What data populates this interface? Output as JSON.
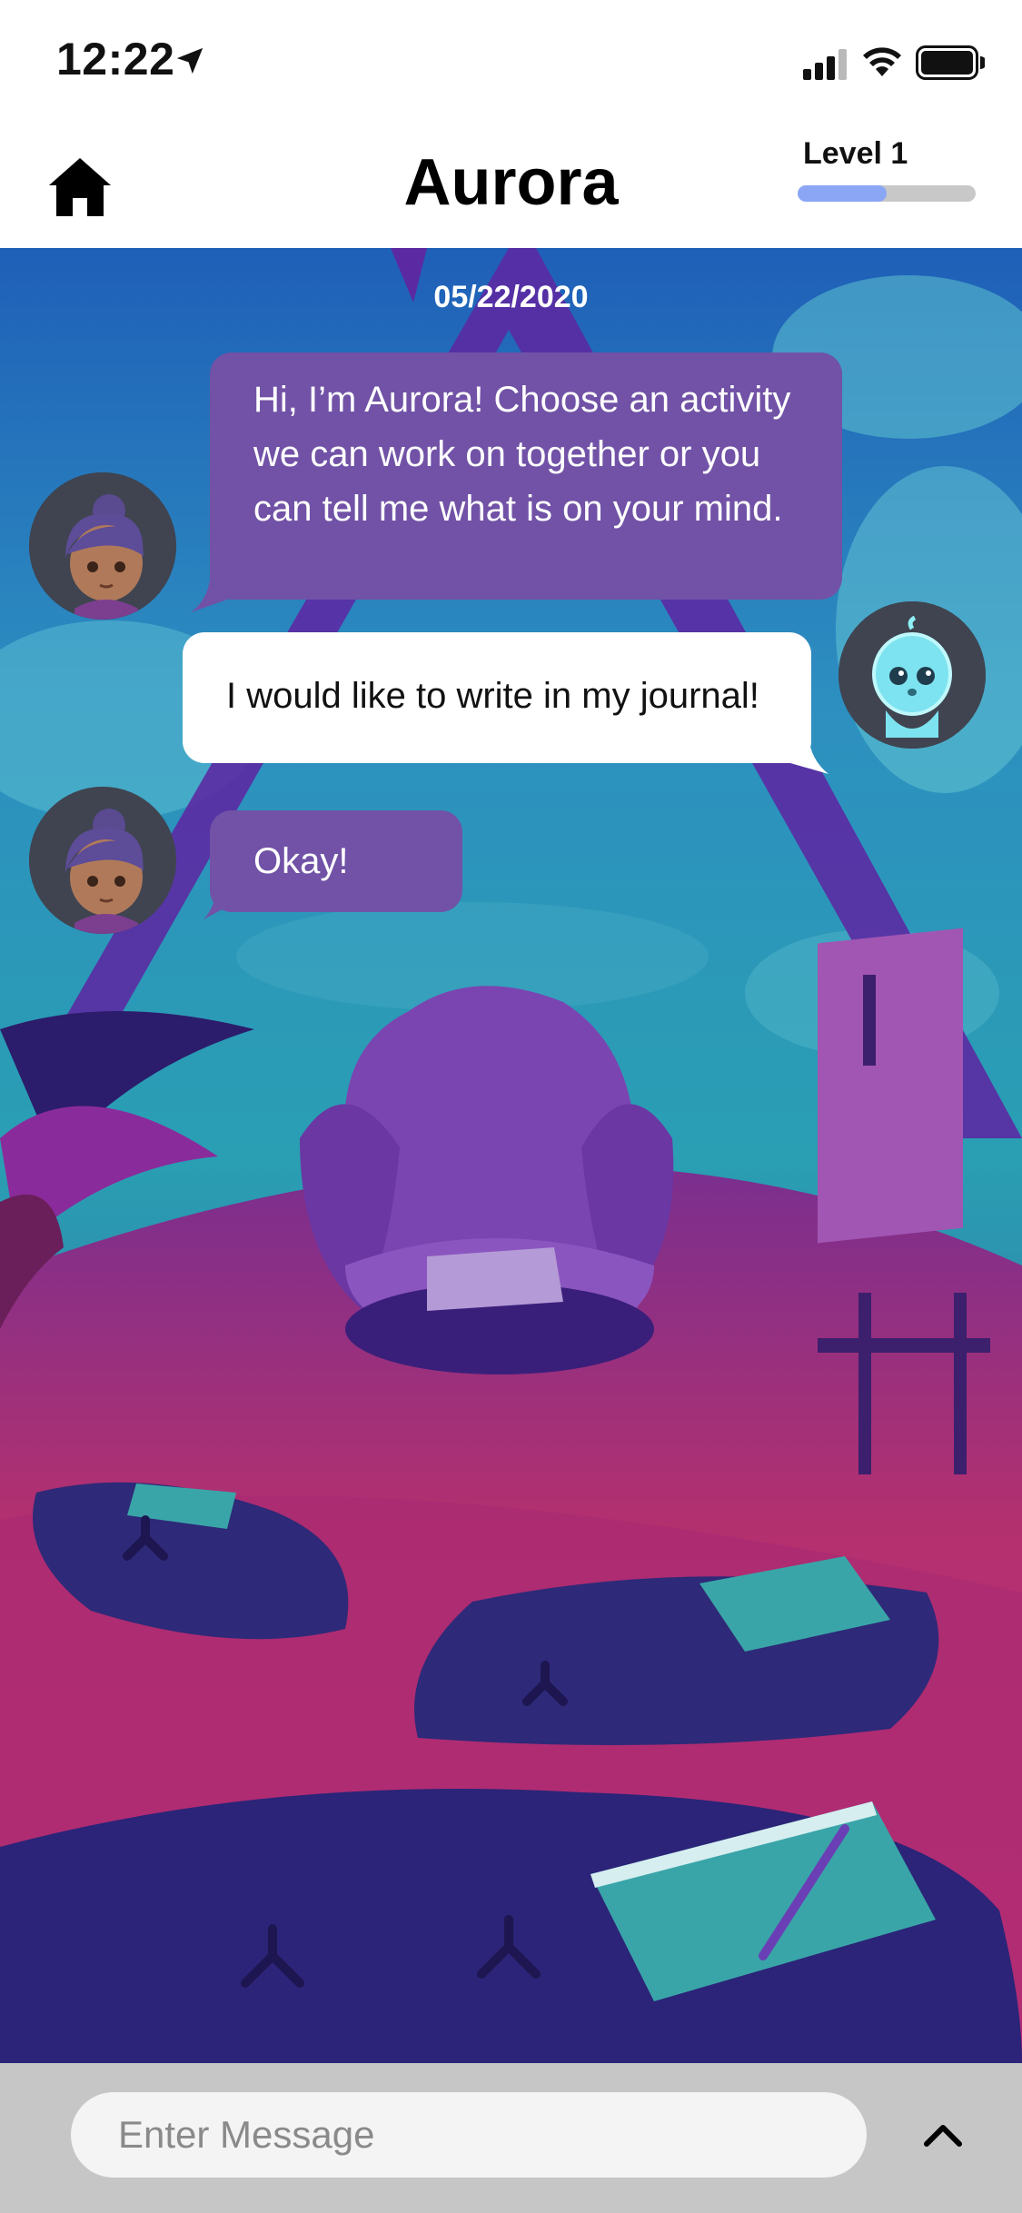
{
  "status_bar": {
    "time": "12:22"
  },
  "header": {
    "title": "Aurora",
    "level_label": "Level 1",
    "level_progress": 0.5
  },
  "chat": {
    "date": "05/22/2020",
    "messages": [
      {
        "sender": "bot",
        "text": "Hi, I’m Aurora! Choose an activity we can work on together or you can tell me what is on your mind."
      },
      {
        "sender": "user",
        "text": "I would like to write in my journal!"
      },
      {
        "sender": "bot",
        "text": "Okay!"
      }
    ]
  },
  "composer": {
    "placeholder": "Enter Message"
  },
  "colors": {
    "bot_bubble": "#7152a6",
    "user_bubble": "#ffffff",
    "level_fill": "#8aa6f5",
    "input_bar": "#c6c6c6"
  }
}
